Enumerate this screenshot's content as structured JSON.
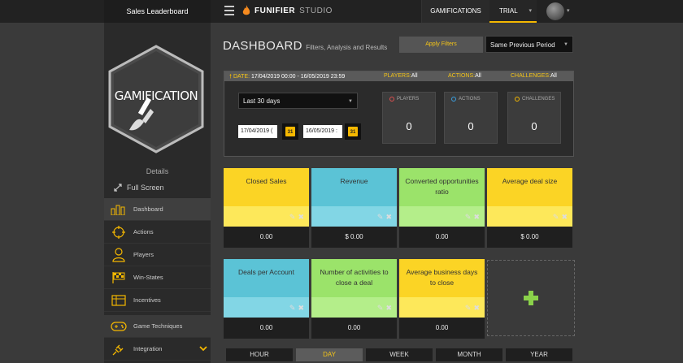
{
  "topbar": {
    "title": "Sales Leaderboard",
    "brand_name": "FUNIFIER",
    "brand_studio": "STUDIO",
    "gamifications_label": "GAMIFICATIONS",
    "trial_label": "TRIAL"
  },
  "sidebar": {
    "logo_text": "GAMIFICATION",
    "details_label": "Details",
    "fullscreen_label": "Full Screen",
    "items": [
      {
        "label": "Dashboard",
        "icon": "bar-chart-icon"
      },
      {
        "label": "Actions",
        "icon": "crosshair-icon"
      },
      {
        "label": "Players",
        "icon": "user-icon"
      },
      {
        "label": "Win-States",
        "icon": "checkered-flag-icon"
      },
      {
        "label": "Incentives",
        "icon": "incentives-icon"
      },
      {
        "label": "Game Techniques",
        "icon": "gamepad-icon"
      },
      {
        "label": "Integration",
        "icon": "plug-icon"
      }
    ]
  },
  "dashboard": {
    "title": "DASHBOARD",
    "subtitle": "Filters, Analysis and Results",
    "apply_label": "Apply Filters",
    "period_value": "Same Previous Period"
  },
  "filters": {
    "date_prefix": "DATE:",
    "date_value": "17/04/2019 00:00 - 16/05/2019 23:59",
    "players_key": "PLAYERS:",
    "players_val": "All",
    "actions_key": "ACTIONS:",
    "actions_val": "All",
    "challenges_key": "CHALLENGES:",
    "challenges_val": "All",
    "range_value": "Last 30 days",
    "date_from": "17/04/2019 (",
    "date_to": "16/05/2019 :",
    "cal_day": "31",
    "stats": [
      {
        "label": "PLAYERS",
        "value": "0",
        "color": "#e05050"
      },
      {
        "label": "ACTIONS",
        "value": "0",
        "color": "#3aa0e0"
      },
      {
        "label": "CHALLENGES",
        "value": "0",
        "color": "#f5b800"
      }
    ]
  },
  "cards": [
    {
      "title": "Closed Sales",
      "value": "0.00",
      "color": "yellow"
    },
    {
      "title": "Revenue",
      "value": "$ 0.00",
      "color": "blue"
    },
    {
      "title": "Converted opportunities ratio",
      "value": "0.00",
      "color": "green"
    },
    {
      "title": "Average deal size",
      "value": "$ 0.00",
      "color": "yellow"
    },
    {
      "title": "Deals per Account",
      "value": "0.00",
      "color": "blue"
    },
    {
      "title": "Number of activities to close a deal",
      "value": "0.00",
      "color": "green"
    },
    {
      "title": "Average business days to close",
      "value": "0.00",
      "color": "yellow"
    }
  ],
  "time_buttons": [
    "HOUR",
    "DAY",
    "WEEK",
    "MONTH",
    "YEAR"
  ],
  "selected_time": "DAY"
}
